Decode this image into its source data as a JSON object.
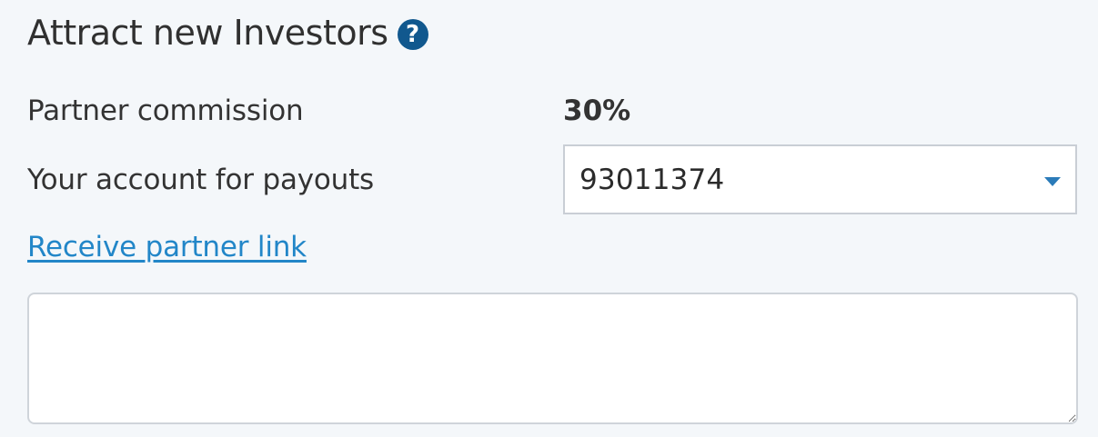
{
  "section": {
    "title": "Attract new Investors",
    "help_icon": "question-circle-icon"
  },
  "commission": {
    "label": "Partner commission",
    "value": "30%"
  },
  "payout_account": {
    "label": "Your account for payouts",
    "selected": "93011374",
    "caret_icon": "chevron-down-icon"
  },
  "partner_link": {
    "label": "Receive partner link",
    "textarea_value": ""
  },
  "colors": {
    "background": "#f4f7fa",
    "accent_link": "#2286c8",
    "help_icon_bg": "#11588e",
    "caret": "#2b7bb9"
  }
}
